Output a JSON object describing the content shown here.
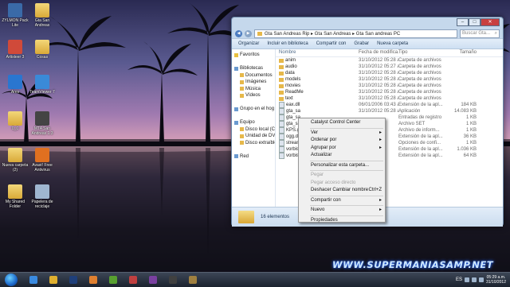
{
  "desktop": {
    "icons": [
      {
        "label": "ZYLMON Pack Lite",
        "icon": "app-icon",
        "color": "#3a6aa8"
      },
      {
        "label": "Gta San Andreas",
        "icon": "folder-icon",
        "color": "#e0b448"
      },
      {
        "label": "Artisteer 3",
        "icon": "app-icon",
        "color": "#d04a3a"
      },
      {
        "label": "Cosas",
        "icon": "folder-icon",
        "color": "#e0b448"
      },
      {
        "label": "Ares",
        "icon": "app-icon",
        "color": "#2a76d0"
      },
      {
        "label": "TeamViewer 7",
        "icon": "app-icon",
        "color": "#3a8ad8"
      },
      {
        "label": "0_0",
        "icon": "folder-icon",
        "color": "#e0b448"
      },
      {
        "label": "MTA San Andreas 1.3",
        "icon": "app-icon",
        "color": "#444444"
      },
      {
        "label": "Nueva carpeta (2)",
        "icon": "folder-icon",
        "color": "#e0b448"
      },
      {
        "label": "Avast! Free Antivirus",
        "icon": "app-icon",
        "color": "#e07020"
      },
      {
        "label": "My Shared Folder",
        "icon": "folder-icon",
        "color": "#e0b448"
      },
      {
        "label": "Papelera de reciclaje",
        "icon": "recycle-bin-icon",
        "color": "#9fb6d0"
      }
    ]
  },
  "window": {
    "breadcrumb": [
      "Gta San Andreas Rip",
      "Gta San Andreas",
      "Gta San andreas PC"
    ],
    "search_placeholder": "Buscar Gta...",
    "toolbar": [
      "Organizar",
      "Incluir en biblioteca",
      "Compartir con",
      "Grabar",
      "Nueva carpeta"
    ],
    "nav": [
      {
        "label": "Favoritos",
        "kind": "star"
      },
      {
        "label": "",
        "kind": "gap"
      },
      {
        "label": "Bibliotecas",
        "kind": "lib"
      },
      {
        "label": "Documentos",
        "kind": "sub"
      },
      {
        "label": "Imágenes",
        "kind": "sub"
      },
      {
        "label": "Música",
        "kind": "sub"
      },
      {
        "label": "Vídeos",
        "kind": "sub"
      },
      {
        "label": "",
        "kind": "gap"
      },
      {
        "label": "Grupo en el hog",
        "kind": "lib"
      },
      {
        "label": "",
        "kind": "gap"
      },
      {
        "label": "Equipo",
        "kind": "lib"
      },
      {
        "label": "Disco local (C:)",
        "kind": "sub"
      },
      {
        "label": "Unidad de DVD",
        "kind": "sub"
      },
      {
        "label": "Disco extraíble",
        "kind": "sub"
      },
      {
        "label": "",
        "kind": "gap"
      },
      {
        "label": "Red",
        "kind": "lib"
      }
    ],
    "columns": {
      "name": "Nombre",
      "date": "Fecha de modifica...",
      "type": "Tipo",
      "size": "Tamaño"
    },
    "rows": [
      {
        "name": "anim",
        "date": "31/10/2012 05:28 a...",
        "type": "Carpeta de archivos",
        "size": "",
        "folder": true
      },
      {
        "name": "audio",
        "date": "31/10/2012 05:27 a...",
        "type": "Carpeta de archivos",
        "size": "",
        "folder": true
      },
      {
        "name": "data",
        "date": "31/10/2012 05:28 a...",
        "type": "Carpeta de archivos",
        "size": "",
        "folder": true
      },
      {
        "name": "models",
        "date": "31/10/2012 05:28 a...",
        "type": "Carpeta de archivos",
        "size": "",
        "folder": true
      },
      {
        "name": "movies",
        "date": "31/10/2012 05:28 a...",
        "type": "Carpeta de archivos",
        "size": "",
        "folder": true
      },
      {
        "name": "ReadMe",
        "date": "31/10/2012 05:28 a...",
        "type": "Carpeta de archivos",
        "size": "",
        "folder": true
      },
      {
        "name": "text",
        "date": "31/10/2012 05:28 a...",
        "type": "Carpeta de archivos",
        "size": "",
        "folder": true
      },
      {
        "name": "eax.dll",
        "date": "06/01/2006 03:43 a...",
        "type": "Extensión de la apl...",
        "size": "184 KB",
        "folder": false
      },
      {
        "name": "gta_sa",
        "date": "31/10/2012 05:28 a...",
        "type": "Aplicación",
        "size": "14.083 KB",
        "folder": false
      },
      {
        "name": "gta_sa",
        "date": "",
        "type": "Entradas de registro",
        "size": "1 KB",
        "folder": false
      },
      {
        "name": "gta_sa",
        "date": "",
        "type": "Archivo SET",
        "size": "1 KB",
        "folder": false
      },
      {
        "name": "KPS.gta...",
        "date": "",
        "type": "Archivo de inform...",
        "size": "1 KB",
        "folder": false
      },
      {
        "name": "ogg.dll",
        "date": "",
        "type": "Extensión de la apl...",
        "size": "36 KB",
        "folder": false
      },
      {
        "name": "stream",
        "date": "",
        "type": "Opciones de confi...",
        "size": "1 KB",
        "folder": false
      },
      {
        "name": "vorbis.dl",
        "date": "",
        "type": "Extensión de la apl...",
        "size": "1.036 KB",
        "folder": false
      },
      {
        "name": "vorbisFil",
        "date": "",
        "type": "Extensión de la apl...",
        "size": "64 KB",
        "folder": false
      }
    ],
    "status": "16 elementos"
  },
  "context_menu": {
    "items": [
      {
        "label": "Catalyst Control Center",
        "arrow": false,
        "disabled": false,
        "sep_after": true
      },
      {
        "label": "Ver",
        "arrow": true,
        "disabled": false,
        "sep_after": false
      },
      {
        "label": "Ordenar por",
        "arrow": true,
        "disabled": false,
        "sep_after": false
      },
      {
        "label": "Agrupar por",
        "arrow": true,
        "disabled": false,
        "sep_after": false
      },
      {
        "label": "Actualizar",
        "arrow": false,
        "disabled": false,
        "sep_after": true
      },
      {
        "label": "Personalizar esta carpeta...",
        "arrow": false,
        "disabled": false,
        "sep_after": true
      },
      {
        "label": "Pegar",
        "arrow": false,
        "disabled": true,
        "sep_after": false
      },
      {
        "label": "Pegar acceso directo",
        "arrow": false,
        "disabled": true,
        "sep_after": false
      },
      {
        "label": "Deshacer Cambiar nombre",
        "shortcut": "Ctrl+Z",
        "arrow": false,
        "disabled": false,
        "sep_after": true
      },
      {
        "label": "Compartir con",
        "arrow": true,
        "disabled": false,
        "sep_after": true
      },
      {
        "label": "Nuevo",
        "arrow": true,
        "disabled": false,
        "sep_after": true
      },
      {
        "label": "Propiedades",
        "arrow": false,
        "disabled": false,
        "sep_after": false
      }
    ]
  },
  "watermark": "WWW.SUPERMANIASAMP.NET",
  "taskbar": {
    "apps": [
      {
        "icon": "ie-icon",
        "color": "#3a8ae0"
      },
      {
        "icon": "chrome-icon",
        "color": "#e0b030"
      },
      {
        "icon": "photoshop-icon",
        "color": "#1f3f7a"
      },
      {
        "icon": "media-player-icon",
        "color": "#e08030"
      },
      {
        "icon": "utorrent-icon",
        "color": "#58a030"
      },
      {
        "icon": "app-icon",
        "color": "#c04040"
      },
      {
        "icon": "app-icon",
        "color": "#7a40a0"
      },
      {
        "icon": "app-icon",
        "color": "#404040"
      },
      {
        "icon": "gta-icon",
        "color": "#a08040"
      }
    ],
    "lang": "ES",
    "time": "05:29 a.m.",
    "date": "31/10/2012"
  }
}
